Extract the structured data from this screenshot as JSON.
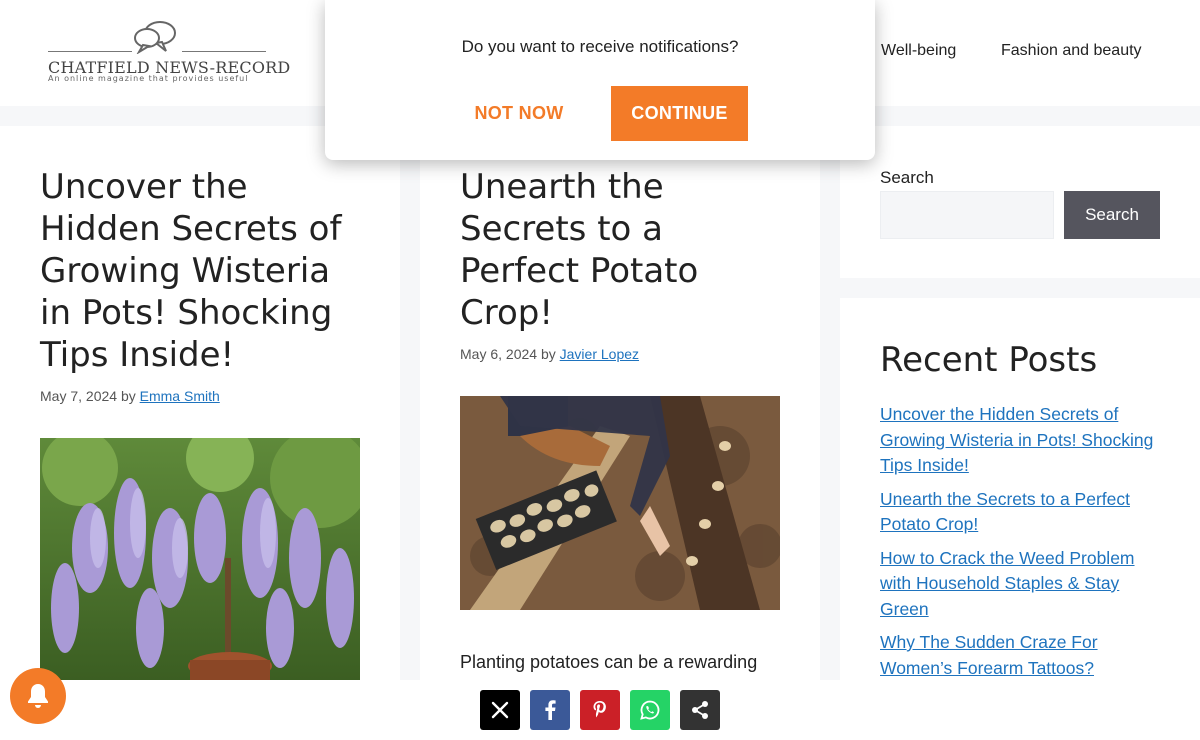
{
  "site": {
    "name": "CHATFIELD NEWS-RECORD",
    "tagline": "An online magazine that provides useful"
  },
  "nav": {
    "items": [
      "Well-being",
      "Fashion and beauty"
    ]
  },
  "popup": {
    "question": "Do you want to receive notifications?",
    "not_now": "NOT NOW",
    "continue": "CONTINUE"
  },
  "posts": [
    {
      "title": "Uncover the Hidden Secrets of Growing Wisteria in Pots! Shocking Tips Inside!",
      "date": "May 7, 2024",
      "by": "by",
      "author": "Emma Smith",
      "image_icon": "wisteria-photo"
    },
    {
      "title": "Unearth the Secrets to a Perfect Potato Crop!",
      "date": "May 6, 2024",
      "by": "by",
      "author": "Javier Lopez",
      "image_icon": "potato-planting-photo",
      "excerpt": "Planting potatoes can be a rewarding"
    }
  ],
  "sidebar": {
    "search_label": "Search",
    "search_value": "",
    "search_button": "Search",
    "recent_title": "Recent Posts",
    "recent": [
      "Uncover the Hidden Secrets of Growing Wisteria in Pots! Shocking Tips Inside!",
      "Unearth the Secrets to a Perfect Potato Crop!",
      "How to Crack the Weed Problem with Household Staples & Stay Green",
      "Why The Sudden Craze For Women’s Forearm Tattoos?"
    ]
  },
  "share": {
    "buttons": [
      {
        "icon": "x-icon",
        "color": "#000000"
      },
      {
        "icon": "facebook-icon",
        "color": "#3b5998"
      },
      {
        "icon": "pinterest-icon",
        "color": "#cb2027"
      },
      {
        "icon": "whatsapp-icon",
        "color": "#25d366"
      },
      {
        "icon": "share-icon",
        "color": "#333333"
      }
    ]
  },
  "colors": {
    "accent": "#f37b28",
    "link": "#1e73be",
    "search_button": "#55555e"
  }
}
